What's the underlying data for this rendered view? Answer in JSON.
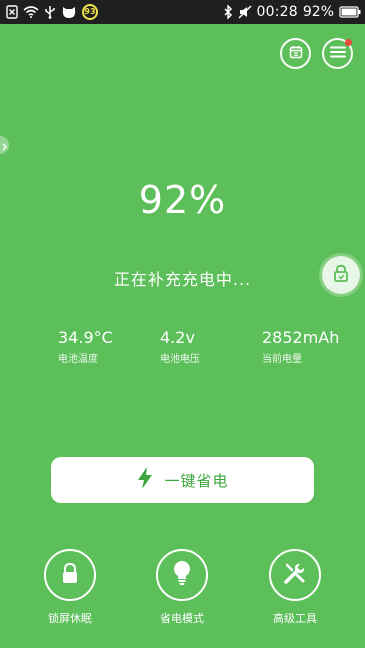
{
  "status_bar": {
    "badge": "93",
    "time": "00:28",
    "battery_percent": "92%"
  },
  "battery": {
    "percent": "92%",
    "status": "正在补充充电中..."
  },
  "stats": [
    {
      "value": "34.9°C",
      "label": "电池温度"
    },
    {
      "value": "4.2v",
      "label": "电池电压"
    },
    {
      "value": "2852mAh",
      "label": "当前电量"
    }
  ],
  "save_button": {
    "label": "一键省电"
  },
  "tools": [
    {
      "label": "锁屏休眠",
      "icon": "lock-icon"
    },
    {
      "label": "省电模式",
      "icon": "bulb-icon"
    },
    {
      "label": "高级工具",
      "icon": "wrench-icon"
    }
  ],
  "colors": {
    "background": "#5cbf5a",
    "accent": "#3ea63e",
    "status_bar": "#1f1f1f",
    "notification_dot": "#e74c3c"
  }
}
